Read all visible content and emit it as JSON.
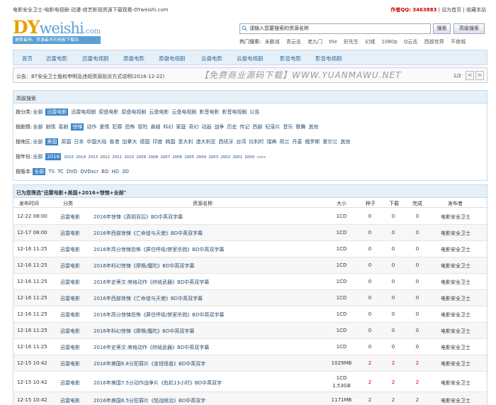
{
  "top": {
    "title": "电影安全卫士-电影电视剧-动漫-综艺影视资源下载观看-DYweishi.com",
    "author_label": "作者QQ:",
    "author_qq": "3463883",
    "home_link": "设为首页",
    "fav_link": "收藏本站"
  },
  "logo": {
    "main_dy": "DY",
    "main_weishi": "weishi",
    "main_com": ".com",
    "sub": "更新最快、资源最多的电影下载站"
  },
  "search": {
    "placeholder": "请输入您要搜索的资源名称",
    "button": "搜索",
    "advanced": "高级搜索",
    "hot_label": "热门搜索:",
    "hot_items": [
      "未删减",
      "青云志",
      "老九门",
      "the",
      "好先生",
      "幻城",
      "1080p",
      "Q云志",
      "西部世界",
      "不夜城"
    ]
  },
  "nav": [
    "首页",
    "迅雷电影",
    "迅雷电视剧",
    "原盘电影",
    "原盘电视剧",
    "云盘电影",
    "云盘电视剧",
    "影音电影",
    "影音电视剧"
  ],
  "notice": {
    "text": "公告：BT安全卫士版权申明及违规资源投诉方式说明(2016-12-22)",
    "page": "1/2",
    "prev": "<",
    "next": ">"
  },
  "watermark": "【免费商业源码下载】WWW.YUANMAWU.NET",
  "filter": {
    "title": "高级搜索",
    "rows": [
      {
        "label": "按分类:",
        "options": [
          "全部",
          "迅雷电影",
          "迅雷电视剧",
          "原盘电影",
          "原盘电视剧",
          "云盘电影",
          "云盘电视剧",
          "影音电影",
          "影音电视剧",
          "公告"
        ],
        "selected": "迅雷电影"
      },
      {
        "label": "按剧情:",
        "options": [
          "全部",
          "剧情",
          "喜剧",
          "惊悚",
          "动作",
          "爱情",
          "犯罪",
          "恐怖",
          "冒险",
          "悬疑",
          "科幻",
          "家庭",
          "奇幻",
          "动画",
          "战争",
          "历史",
          "传记",
          "西部",
          "纪录片",
          "音乐",
          "歌舞",
          "其他"
        ],
        "selected": "惊悚"
      },
      {
        "label": "按地区:",
        "options": [
          "全部",
          "美国",
          "英国",
          "日本",
          "中国大陆",
          "香港",
          "加拿大",
          "德国",
          "印度",
          "韩国",
          "意大利",
          "澳大利亚",
          "西班牙",
          "台湾",
          "比利时",
          "瑞典",
          "荷兰",
          "丹麦",
          "俄罗斯",
          "爱尔兰",
          "其他"
        ],
        "selected": "美国"
      },
      {
        "label": "按年份:",
        "options": [
          "全部",
          "2016",
          "2015",
          "2014",
          "2013",
          "2012",
          "2011",
          "2010",
          "2009",
          "2008",
          "2007",
          "2006",
          "2005",
          "2004",
          "2003",
          "2002",
          "2001",
          "2000"
        ],
        "selected": "2016",
        "more": "more"
      },
      {
        "label": "按版本:",
        "options": [
          "全部",
          "TS",
          "TC",
          "DVD",
          "DVDscr",
          "BD",
          "HD",
          "3D"
        ],
        "selected": "全部"
      }
    ]
  },
  "results": {
    "title": "已为您筛选\"迅雷电影+美国+2016+惊悚+全部\"",
    "columns": [
      "发布时间",
      "分类",
      "资源名称",
      "大小",
      "种子",
      "下载",
      "完成",
      "发布者"
    ],
    "rows": [
      {
        "time": "12-22 08:00",
        "cat": "迅雷电影",
        "name": "2016年惊悚《真相背后》BD中英双字幕",
        "size": "1CD",
        "seeds": "0",
        "dl": "0",
        "done": "0",
        "pub": "电影安全卫士"
      },
      {
        "time": "12-17 08:00",
        "cat": "迅雷电影",
        "name": "2016年西部惊悚《亡命徒与天使》BD中英双字幕",
        "size": "1CD",
        "seeds": "0",
        "dl": "0",
        "done": "0",
        "pub": "电影安全卫士"
      },
      {
        "time": "12-16 11:25",
        "cat": "迅雷电影",
        "name": "2016年高分惊悚恐怖《屏住呼吸/禁室杀戮》BD中英双字幕",
        "size": "1CD",
        "seeds": "0",
        "dl": "0",
        "done": "0",
        "pub": "电影安全卫士"
      },
      {
        "time": "12-16 11:25",
        "cat": "迅雷电影",
        "name": "2016年科幻惊悚《摩根/魔陀》BD中英双字幕",
        "size": "1CD",
        "seeds": "0",
        "dl": "0",
        "done": "0",
        "pub": "电影安全卫士"
      },
      {
        "time": "12-16 11:25",
        "cat": "迅雷电影",
        "name": "2016年史蒂文·席格动作《终结武器》BD中英双字幕",
        "size": "1CD",
        "seeds": "0",
        "dl": "0",
        "done": "0",
        "pub": "电影安全卫士"
      },
      {
        "time": "12-16 11:25",
        "cat": "迅雷电影",
        "name": "2016年西部惊悚《亡命徒与天使》BD中英双字幕",
        "size": "1CD",
        "seeds": "0",
        "dl": "0",
        "done": "0",
        "pub": "电影安全卫士"
      },
      {
        "time": "12-16 11:25",
        "cat": "迅雷电影",
        "name": "2016年高分惊悚恐怖《屏住呼吸/禁室杀戮》BD中英双字幕",
        "size": "1CD",
        "seeds": "0",
        "dl": "0",
        "done": "0",
        "pub": "电影安全卫士"
      },
      {
        "time": "12-16 11:25",
        "cat": "迅雷电影",
        "name": "2016年科幻惊悚《摩根/魔陀》BD中英双字幕",
        "size": "1CD",
        "seeds": "0",
        "dl": "0",
        "done": "0",
        "pub": "电影安全卫士"
      },
      {
        "time": "12-16 11:25",
        "cat": "迅雷电影",
        "name": "2016年史蒂文·席格动作《终结武器》BD中英双字幕",
        "size": "1CD",
        "seeds": "0",
        "dl": "0",
        "done": "0",
        "pub": "电影安全卫士"
      },
      {
        "time": "12-15 10:42",
        "cat": "迅雷电影",
        "name": "2016年美国6.8分犯罪片《金钱怪兽》BD中英双字",
        "size": "1029MB",
        "seeds": "2",
        "dl": "2",
        "done": "2",
        "pub": "电影安全卫士"
      },
      {
        "time": "12-15 10:42",
        "cat": "迅雷电影",
        "name": "2016年美国7.5分动作战争片《危机13小时》BD中英双字",
        "size": "1CD",
        "size2": "1.53GB",
        "seeds": "2",
        "dl": "2",
        "done": "2",
        "pub": "电影安全卫士"
      },
      {
        "time": "12-15 10:42",
        "cat": "迅雷电影",
        "name": "2016年美国6.5分犯罪片《怒战统治》BD中英双字",
        "size": "1171MB",
        "seeds": "2",
        "dl": "2",
        "done": "2",
        "pub": "电影安全卫士"
      }
    ]
  }
}
